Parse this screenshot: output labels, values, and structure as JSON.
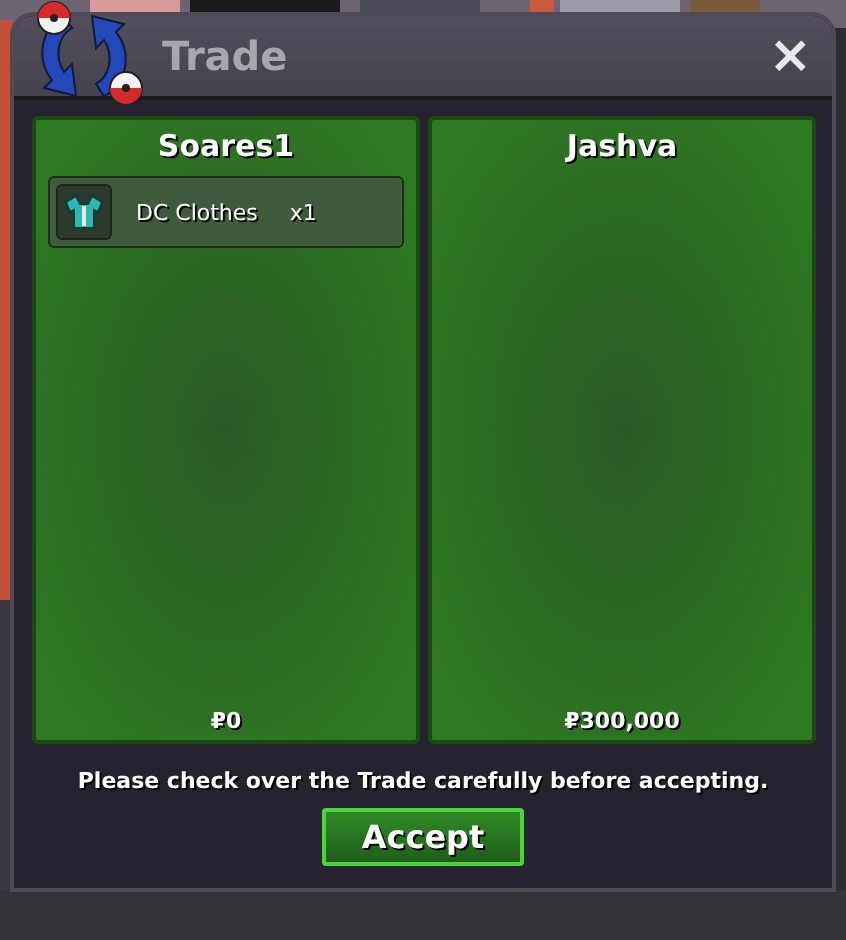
{
  "window": {
    "title": "Trade",
    "close": "×"
  },
  "panels": [
    {
      "player": "Soares1",
      "items": [
        {
          "name": "DC Clothes",
          "quantity": "x1"
        }
      ],
      "money": "₽0"
    },
    {
      "player": "Jashva",
      "money": "₽300,000"
    }
  ],
  "notice": "Please check over the Trade carefully before accepting.",
  "buttons": [
    "Accept"
  ]
}
